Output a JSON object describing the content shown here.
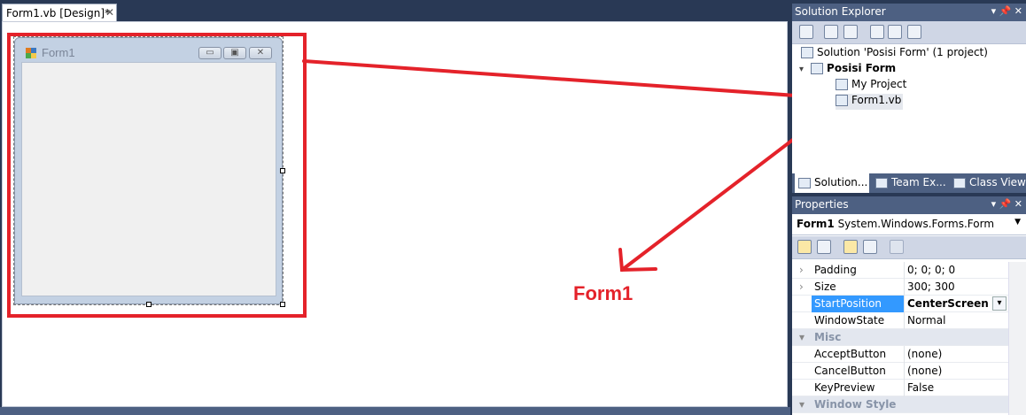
{
  "document_tab": {
    "label": "Form1.vb [Design]*",
    "close_glyph": "✕"
  },
  "design_form": {
    "caption": "Form1",
    "icon": "app-form-icon",
    "min_glyph": "▭",
    "max_glyph": "▣",
    "close_glyph": "✕"
  },
  "annotation": {
    "label": "Form1",
    "color": "#e4222a"
  },
  "solution_explorer": {
    "title": "Solution Explorer",
    "title_buttons": "▾ 📌 ✕",
    "tree": [
      {
        "label": "Solution 'Posisi Form' (1 project)",
        "icon": "solution-icon"
      },
      {
        "label": "Posisi Form",
        "icon": "vb-project-icon",
        "bold": true
      },
      {
        "label": "My Project",
        "icon": "my-project-icon"
      },
      {
        "label": "Form1.vb",
        "icon": "form-file-icon"
      }
    ],
    "tabs": [
      "Solution...",
      "Team Ex...",
      "Class View"
    ]
  },
  "properties": {
    "title": "Properties",
    "title_buttons": "▾ 📌 ✕",
    "selector_object": "Form1",
    "selector_type": "System.Windows.Forms.Form",
    "rows": [
      {
        "expand": "›",
        "name": "Padding",
        "value": "0; 0; 0; 0"
      },
      {
        "expand": "›",
        "name": "Size",
        "value": "300; 300"
      },
      {
        "expand": "",
        "name": "StartPosition",
        "value": "CenterScreen",
        "selected": true
      },
      {
        "expand": "",
        "name": "WindowState",
        "value": "Normal"
      },
      {
        "expand": "▾",
        "name": "Misc",
        "value": "",
        "category": true
      },
      {
        "expand": "",
        "name": "AcceptButton",
        "value": "(none)"
      },
      {
        "expand": "",
        "name": "CancelButton",
        "value": "(none)"
      },
      {
        "expand": "",
        "name": "KeyPreview",
        "value": "False"
      },
      {
        "expand": "▾",
        "name": "Window Style",
        "value": "",
        "category": true
      }
    ]
  }
}
